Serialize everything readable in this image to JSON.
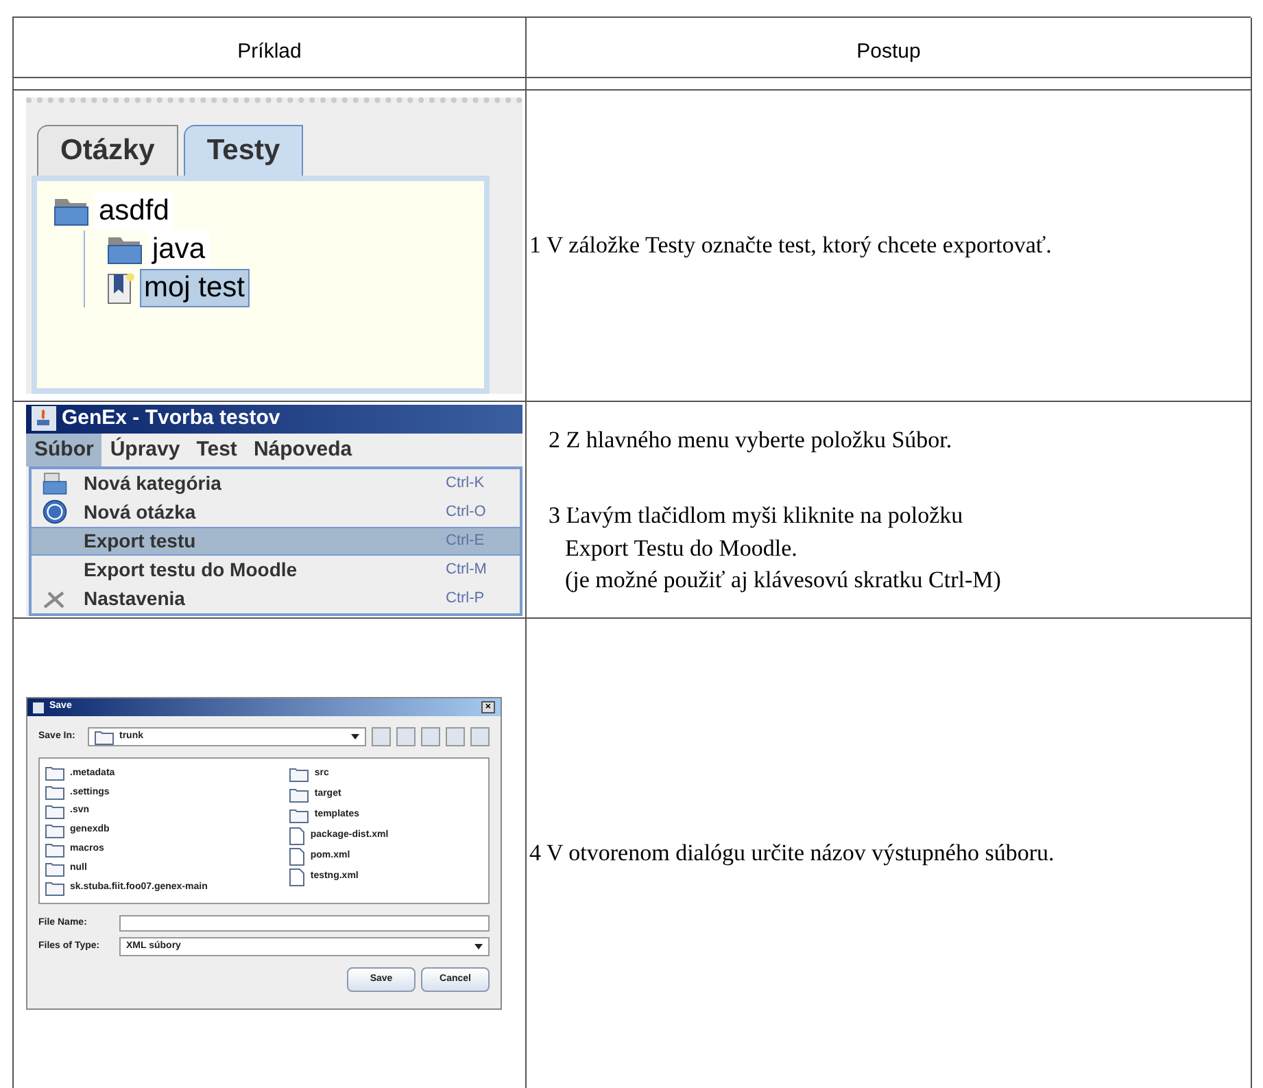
{
  "table": {
    "columns": [
      "Príklad",
      "Postup"
    ],
    "rows": [
      {
        "kind": "tree",
        "steps": [
          [
            "1 V záložke Testy označte test, ktorý chcete exportovať."
          ]
        ],
        "tabs": [
          {
            "label": "Otázky",
            "selected": false
          },
          {
            "label": "Testy",
            "selected": true
          }
        ],
        "tree": [
          {
            "label": "asdfd",
            "kind": "folder",
            "selected": false,
            "children": [
              {
                "label": "java",
                "kind": "folder",
                "selected": false
              },
              {
                "label": "moj test",
                "kind": "test",
                "selected": true
              }
            ]
          }
        ]
      },
      {
        "kind": "menu",
        "steps": [
          [
            "2 Z hlavného menu vyberte položku Súbor."
          ],
          [
            "3 Ľavým tlačidlom myši kliknite na položku",
            "Export Testu do Moodle.",
            "(je možné použiť aj klávesovú skratku Ctrl-M)"
          ]
        ],
        "title": "GenEx - Tvorba testov",
        "menubar": [
          {
            "label": "Súbor",
            "selected": true
          },
          {
            "label": "Úpravy",
            "selected": false
          },
          {
            "label": "Test",
            "selected": false
          },
          {
            "label": "Nápoveda",
            "selected": false
          }
        ],
        "items": [
          {
            "label": "Nová kategória",
            "shortcut": "Ctrl-K",
            "kind": "folder",
            "selected": false
          },
          {
            "label": "Nová otázka",
            "shortcut": "Ctrl-O",
            "kind": "help",
            "selected": false
          },
          {
            "label": "Export testu",
            "shortcut": "Ctrl-E",
            "kind": "plain",
            "selected": true
          },
          {
            "label": "Export testu do Moodle",
            "shortcut": "Ctrl-M",
            "kind": "plain",
            "selected": false
          },
          {
            "label": "Nastavenia",
            "shortcut": "Ctrl-P",
            "kind": "tools",
            "selected": false
          }
        ]
      },
      {
        "kind": "dialog",
        "steps": [
          [
            "4 V otvorenom dialógu určite názov výstupného súboru."
          ]
        ],
        "title": "Save",
        "close": "×",
        "save_in_label": "Save In:",
        "save_in": "trunk",
        "files": [
          {
            "name": ".metadata",
            "kind": "folder"
          },
          {
            "name": ".settings",
            "kind": "folder"
          },
          {
            "name": ".svn",
            "kind": "folder"
          },
          {
            "name": "genexdb",
            "kind": "folder"
          },
          {
            "name": "macros",
            "kind": "folder"
          },
          {
            "name": "null",
            "kind": "folder"
          },
          {
            "name": "sk.stuba.fiit.foo07.genex-main",
            "kind": "folder"
          },
          {
            "name": "src",
            "kind": "folder"
          },
          {
            "name": "target",
            "kind": "folder"
          },
          {
            "name": "templates",
            "kind": "folder"
          },
          {
            "name": "package-dist.xml",
            "kind": "file"
          },
          {
            "name": "pom.xml",
            "kind": "file"
          },
          {
            "name": "testng.xml",
            "kind": "file"
          }
        ],
        "file_name_label": "File Name:",
        "file_type_label": "Files of Type:",
        "file_type": "XML súbory",
        "buttons": [
          "Save",
          "Cancel"
        ]
      }
    ]
  }
}
